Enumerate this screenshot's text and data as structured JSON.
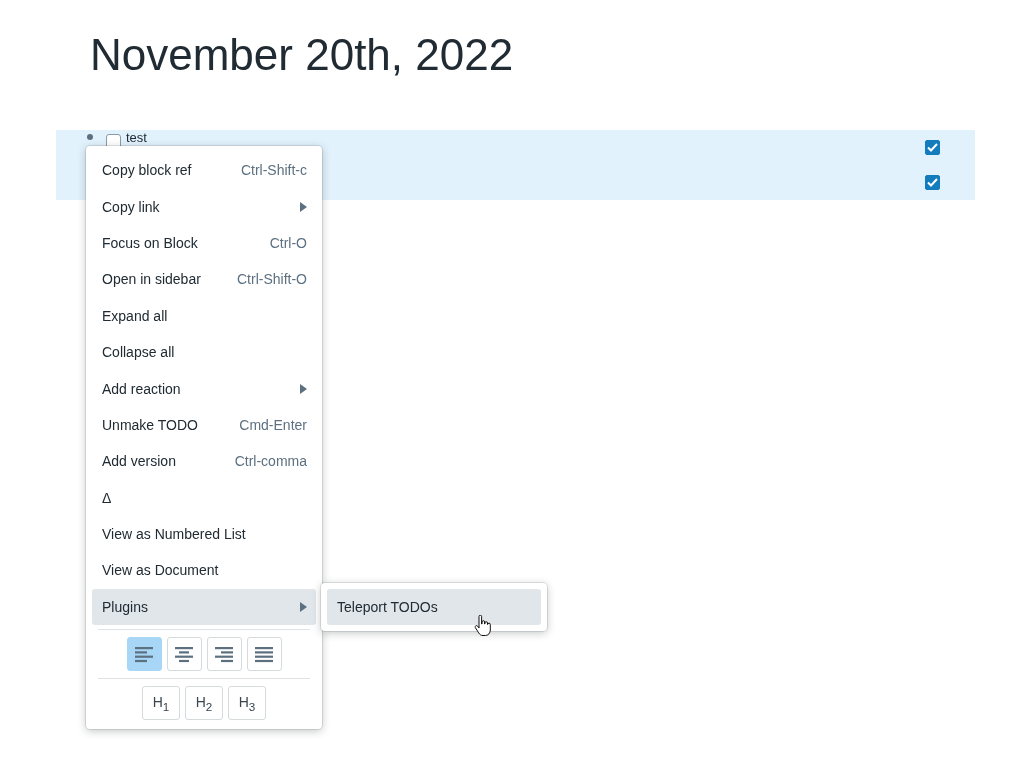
{
  "title": "November 20th, 2022",
  "blocks": [
    {
      "text": "test",
      "checked": false,
      "right_checked": true
    },
    {
      "right_checked": true
    }
  ],
  "context_menu": {
    "items": [
      {
        "kind": "shortcut",
        "label": "Copy block ref",
        "shortcut": "Ctrl-Shift-c",
        "selected": false
      },
      {
        "kind": "submenu",
        "label": "Copy link",
        "selected": false
      },
      {
        "kind": "shortcut",
        "label": "Focus on Block",
        "shortcut": "Ctrl-O",
        "selected": false
      },
      {
        "kind": "shortcut",
        "label": "Open in sidebar",
        "shortcut": "Ctrl-Shift-O",
        "selected": false
      },
      {
        "kind": "plain",
        "label": "Expand all",
        "selected": false
      },
      {
        "kind": "plain",
        "label": "Collapse all",
        "selected": false
      },
      {
        "kind": "submenu",
        "label": "Add reaction",
        "selected": false
      },
      {
        "kind": "shortcut",
        "label": "Unmake TODO",
        "shortcut": "Cmd-Enter",
        "selected": false
      },
      {
        "kind": "shortcut",
        "label": "Add version",
        "shortcut": "Ctrl-comma",
        "selected": false
      },
      {
        "kind": "plain",
        "label": "Δ",
        "selected": false
      },
      {
        "kind": "plain",
        "label": "View as Numbered List",
        "selected": false
      },
      {
        "kind": "plain",
        "label": "View as Document",
        "selected": false
      },
      {
        "kind": "submenu",
        "label": "Plugins",
        "selected": true
      }
    ],
    "alignments": [
      {
        "kind": "left",
        "selected": true
      },
      {
        "kind": "center",
        "selected": false
      },
      {
        "kind": "right",
        "selected": false
      },
      {
        "kind": "justify",
        "selected": false
      }
    ],
    "headings": [
      "H$_{1}$",
      "H$_{2}$",
      "H$_{3}$"
    ]
  },
  "submenu": {
    "items": [
      {
        "label": "Teleport TODOs",
        "selected": true
      }
    ]
  }
}
